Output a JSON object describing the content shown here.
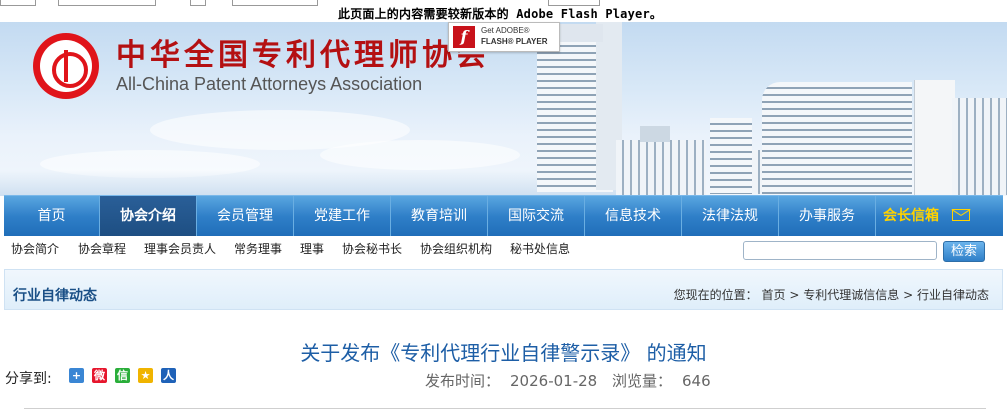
{
  "flash_notice": {
    "message": "此页面上的内容需要较新版本的 Adobe Flash Player。"
  },
  "header": {
    "site_name_cn": "中华全国专利代理师协会",
    "site_name_en": "All-China Patent Attorneys Association",
    "flash_badge": {
      "line1": "Get ADOBE®",
      "line2": "FLASH® PLAYER"
    }
  },
  "nav": {
    "items": [
      {
        "label": "首页"
      },
      {
        "label": "协会介绍"
      },
      {
        "label": "会员管理"
      },
      {
        "label": "党建工作"
      },
      {
        "label": "教育培训"
      },
      {
        "label": "国际交流"
      },
      {
        "label": "信息技术"
      },
      {
        "label": "法律法规"
      },
      {
        "label": "办事服务"
      },
      {
        "label": "会长信箱"
      }
    ],
    "active_index": 1
  },
  "subnav": {
    "items": [
      "协会简介",
      "协会章程",
      "理事会员责人",
      "常务理事",
      "理事",
      "协会秘书长",
      "协会组织机构",
      "秘书处信息"
    ]
  },
  "search": {
    "button_label": "检索",
    "value": ""
  },
  "section": {
    "title": "行业自律动态",
    "breadcrumb_prefix": "您现在的位置：",
    "breadcrumb": [
      "首页",
      "专利代理诚信信息",
      "行业自律动态"
    ],
    "separator": ">"
  },
  "article": {
    "title": "关于发布《专利代理行业自律警示录》 的通知",
    "publish_label": "发布时间：",
    "publish_date": "2026-01-28",
    "views_label": "浏览量：",
    "views": "646"
  },
  "share": {
    "label": "分享到:",
    "icons": [
      {
        "name": "more",
        "glyph": "+",
        "color": "#3a86d4"
      },
      {
        "name": "weibo",
        "glyph": "微",
        "color": "#e6162d"
      },
      {
        "name": "wechat",
        "glyph": "信",
        "color": "#2aae3a"
      },
      {
        "name": "qzone",
        "glyph": "★",
        "color": "#f0b400"
      },
      {
        "name": "renren",
        "glyph": "人",
        "color": "#1f62b8"
      }
    ]
  }
}
